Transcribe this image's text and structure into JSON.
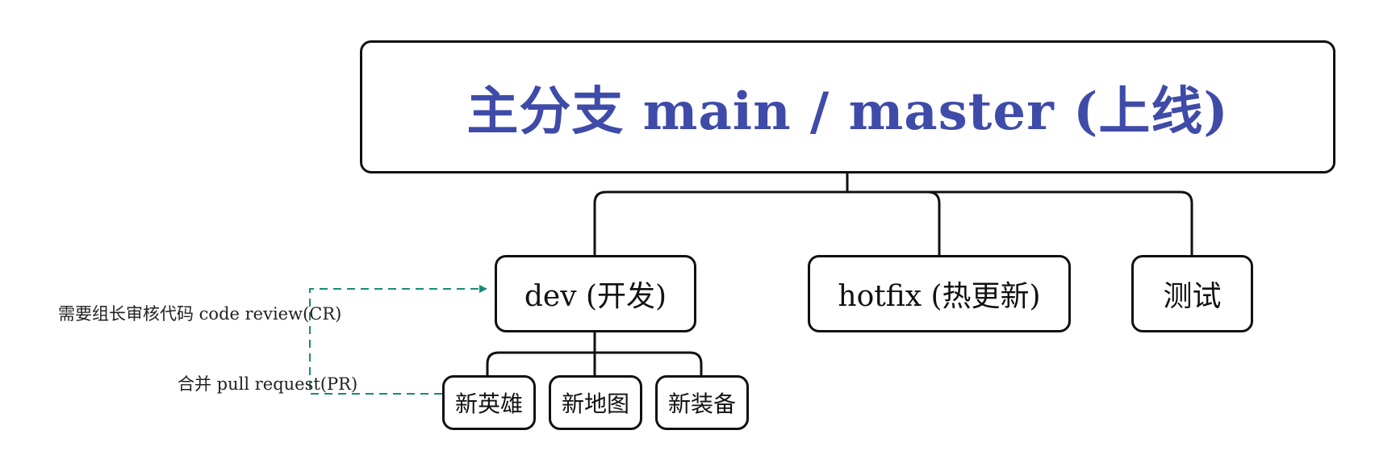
{
  "root": {
    "title": "主分支 main / master (上线)"
  },
  "branches": {
    "dev": "dev (开发)",
    "hotfix": "hotfix (热更新)",
    "test": "测试"
  },
  "features": [
    "新英雄",
    "新地图",
    "新装备"
  ],
  "annotations": {
    "code_review": "需要组长审核代码 code review(CR)",
    "pull_request": "合并 pull request(PR)"
  },
  "colors": {
    "title": "#3f4ba8",
    "dashed_arrow": "#1a8a7a",
    "border": "#111111"
  }
}
